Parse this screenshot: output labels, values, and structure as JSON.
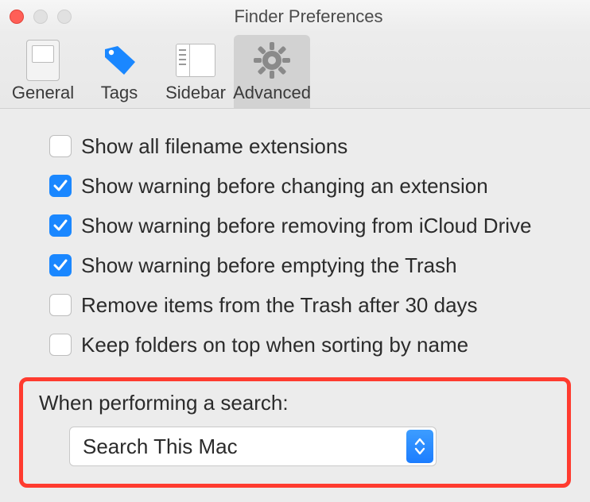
{
  "window": {
    "title": "Finder Preferences"
  },
  "tabs": {
    "general": "General",
    "tags": "Tags",
    "sidebar": "Sidebar",
    "advanced": "Advanced"
  },
  "checks": {
    "ext": {
      "label": "Show all filename extensions",
      "checked": false
    },
    "warn_ext": {
      "label": "Show warning before changing an extension",
      "checked": true
    },
    "warn_icloud": {
      "label": "Show warning before removing from iCloud Drive",
      "checked": true
    },
    "warn_trash": {
      "label": "Show warning before emptying the Trash",
      "checked": true
    },
    "auto_trash": {
      "label": "Remove items from the Trash after 30 days",
      "checked": false
    },
    "folders_top": {
      "label": "Keep folders on top when sorting by name",
      "checked": false
    }
  },
  "search": {
    "title": "When performing a search:",
    "selected": "Search This Mac"
  }
}
